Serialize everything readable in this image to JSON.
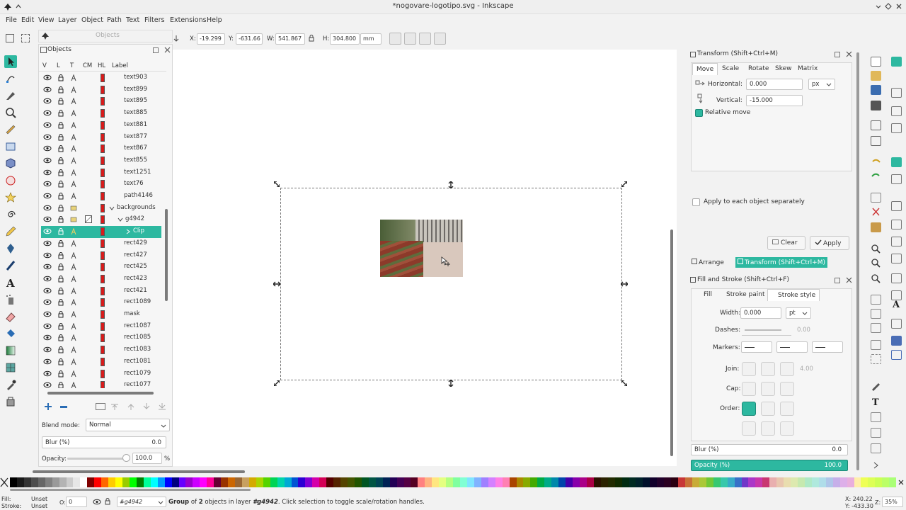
{
  "window": {
    "title": "*nogovare-logotipo.svg - Inkscape"
  },
  "menu": [
    "File",
    "Edit",
    "View",
    "Layer",
    "Object",
    "Path",
    "Text",
    "Filters",
    "Extensions",
    "Help"
  ],
  "toolbar": {
    "x_label": "X:",
    "x_value": "-19.299",
    "y_label": "Y:",
    "y_value": "-631.66",
    "w_label": "W:",
    "w_value": "541.867",
    "h_label": "H:",
    "h_value": "304.800",
    "unit": "mm"
  },
  "objects_panel": {
    "floating_title": "Objects",
    "title": "Objects",
    "columns": [
      "V",
      "L",
      "T",
      "CM",
      "HL",
      "Label"
    ],
    "rows": [
      {
        "label": "text903",
        "indent": 0
      },
      {
        "label": "text899",
        "indent": 0
      },
      {
        "label": "text895",
        "indent": 0
      },
      {
        "label": "text885",
        "indent": 0
      },
      {
        "label": "text881",
        "indent": 0
      },
      {
        "label": "text877",
        "indent": 0
      },
      {
        "label": "text867",
        "indent": 0
      },
      {
        "label": "text855",
        "indent": 0
      },
      {
        "label": "text1251",
        "indent": 0
      },
      {
        "label": "text76",
        "indent": 0
      },
      {
        "label": "path4146",
        "indent": 0
      },
      {
        "label": "backgrounds",
        "indent": 0,
        "group": true
      },
      {
        "label": "g4942",
        "indent": 1,
        "group": true
      },
      {
        "label": "Clip",
        "indent": 2,
        "selected": true
      },
      {
        "label": "rect429",
        "indent": 0
      },
      {
        "label": "rect427",
        "indent": 0
      },
      {
        "label": "rect425",
        "indent": 0
      },
      {
        "label": "rect423",
        "indent": 0
      },
      {
        "label": "rect421",
        "indent": 0
      },
      {
        "label": "rect1089",
        "indent": 0
      },
      {
        "label": "mask",
        "indent": 0
      },
      {
        "label": "rect1087",
        "indent": 0
      },
      {
        "label": "rect1085",
        "indent": 0
      },
      {
        "label": "rect1083",
        "indent": 0
      },
      {
        "label": "rect1081",
        "indent": 0
      },
      {
        "label": "rect1079",
        "indent": 0
      },
      {
        "label": "rect1077",
        "indent": 0
      }
    ],
    "blend_mode_label": "Blend mode:",
    "blend_mode_value": "Normal",
    "blur_label": "Blur (%)",
    "blur_value": "0.0",
    "opacity_label": "Opacity:",
    "opacity_value": "100.0",
    "opacity_unit": "%"
  },
  "transform_panel": {
    "title": "Transform (Shift+Ctrl+M)",
    "tabs": [
      "Move",
      "Scale",
      "Rotate",
      "Skew",
      "Matrix"
    ],
    "horizontal_label": "Horizontal:",
    "horizontal_value": "0.000",
    "vertical_label": "Vertical:",
    "vertical_value": "-15.000",
    "unit": "px",
    "relative_move_label": "Relative move",
    "apply_each_label": "Apply to each object separately",
    "clear_label": "Clear",
    "apply_label": "Apply"
  },
  "dock_tabs": {
    "arrange": "Arrange",
    "transform": "Transform (Shift+Ctrl+M)"
  },
  "fill_stroke_panel": {
    "title": "Fill and Stroke (Shift+Ctrl+F)",
    "tabs": [
      "Fill",
      "Stroke paint",
      "Stroke style"
    ],
    "width_label": "Width:",
    "width_value": "0.000",
    "width_unit": "pt",
    "dashes_label": "Dashes:",
    "dashes_value": "0.00",
    "markers_label": "Markers:",
    "join_label": "Join:",
    "join_value": "4.00",
    "cap_label": "Cap:",
    "order_label": "Order:",
    "blur_label": "Blur (%)",
    "blur_value": "0.0",
    "opacity_label": "Opacity (%)",
    "opacity_value": "100.0"
  },
  "statusbar": {
    "fill_label": "Fill:",
    "fill_value": "Unset",
    "stroke_label": "Stroke:",
    "stroke_value": "Unset",
    "o_label": "O:",
    "o_value": "0",
    "layer": "#g4942",
    "message_bold": "Group",
    "message_rest1": " of ",
    "message_bold2": "2",
    "message_rest2": " objects in layer ",
    "message_bold3": "#g4942",
    "message_rest3": ". Click selection to toggle scale/rotation handles.",
    "x_coord": "X: 240.22",
    "y_coord": "Y: -433.30",
    "z_label": "Z:",
    "zoom": "35%"
  },
  "colors": {
    "accent": "#2db8a0",
    "selection_row": "#2db8a0",
    "background": "#f2f2f2"
  }
}
